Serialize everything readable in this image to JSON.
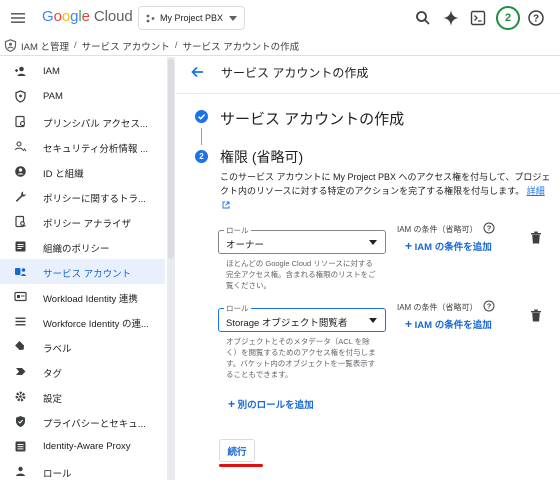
{
  "header": {
    "logo_parts": [
      "G",
      "o",
      "o",
      "g",
      "l",
      "e",
      " Cloud"
    ],
    "project": "My Project PBX",
    "avatar_initial": "2",
    "icons": [
      "menu-icon",
      "search-icon",
      "gemini-sparkle-icon",
      "cloud-shell-icon",
      "help-icon"
    ]
  },
  "breadcrumb": {
    "items": [
      "IAM と管理",
      "サービス アカウント",
      "サービス アカウントの作成"
    ],
    "separator": "/"
  },
  "sidebar": {
    "items": [
      {
        "label": "IAM",
        "icon": "person-add-icon",
        "active": false
      },
      {
        "label": "PAM",
        "icon": "shield-icon",
        "active": false
      },
      {
        "label": "プリンシパル アクセス...",
        "icon": "policy-icon",
        "active": false
      },
      {
        "label": "セキュリティ分析情報 ...",
        "icon": "people-analytics-icon",
        "active": false
      },
      {
        "label": "ID と組織",
        "icon": "account-circle-icon",
        "active": false
      },
      {
        "label": "ポリシーに関するトラ...",
        "icon": "wrench-icon",
        "active": false
      },
      {
        "label": "ポリシー アナライザ",
        "icon": "doc-search-icon",
        "active": false
      },
      {
        "label": "組織のポリシー",
        "icon": "article-icon",
        "active": false
      },
      {
        "label": "サービス アカウント",
        "icon": "service-account-icon",
        "active": true
      },
      {
        "label": "Workload Identity 連携",
        "icon": "id-card-icon",
        "active": false
      },
      {
        "label": "Workforce Identity の連...",
        "icon": "list-icon",
        "active": false
      },
      {
        "label": "ラベル",
        "icon": "label-icon",
        "active": false
      },
      {
        "label": "タグ",
        "icon": "tag-arrow-icon",
        "active": false
      },
      {
        "label": "設定",
        "icon": "gear-icon",
        "active": false
      },
      {
        "label": "プライバシーとセキュ...",
        "icon": "privacy-shield-icon",
        "active": false
      },
      {
        "label": "Identity-Aware Proxy",
        "icon": "iap-icon",
        "active": false
      },
      {
        "label": "ロール",
        "icon": "role-icon",
        "active": false
      }
    ]
  },
  "main": {
    "page_title": "サービス アカウントの作成",
    "step1_title": "サービス アカウントの作成",
    "step2_number": "2",
    "step2_title": "権限 (省略可)",
    "description": "このサービス アカウントに My Project PBX へのアクセス権を付与して、プロジェクト内のリソースに対する特定のアクションを完了する権限を付与します。",
    "details_link": "詳細",
    "roles": [
      {
        "field_label": "ロール",
        "value": "オーナー",
        "helper": "ほとんどの Google Cloud リソースに対する完全アクセス権。含まれる権限のリストをご覧ください。",
        "condition_label": "IAM の条件（省略可）",
        "add_condition": "IAM の条件を追加"
      },
      {
        "field_label": "ロール",
        "value": "Storage オブジェクト閲覧者",
        "helper": "オブジェクトとそのメタデータ（ACL を除く）を閲覧するためのアクセス権を付与します。バケット内のオブジェクトを一覧表示することもできます。",
        "condition_label": "IAM の条件（省略可）",
        "add_condition": "IAM の条件を追加"
      }
    ],
    "add_role": "別のロールを追加",
    "continue_button": "続行"
  },
  "colors": {
    "accent": "#1a73e8",
    "link": "#1967d2",
    "active_bg": "#e8f0fe",
    "avatar_ring": "#1e8e3e",
    "annotation_underline": "#e01010"
  }
}
